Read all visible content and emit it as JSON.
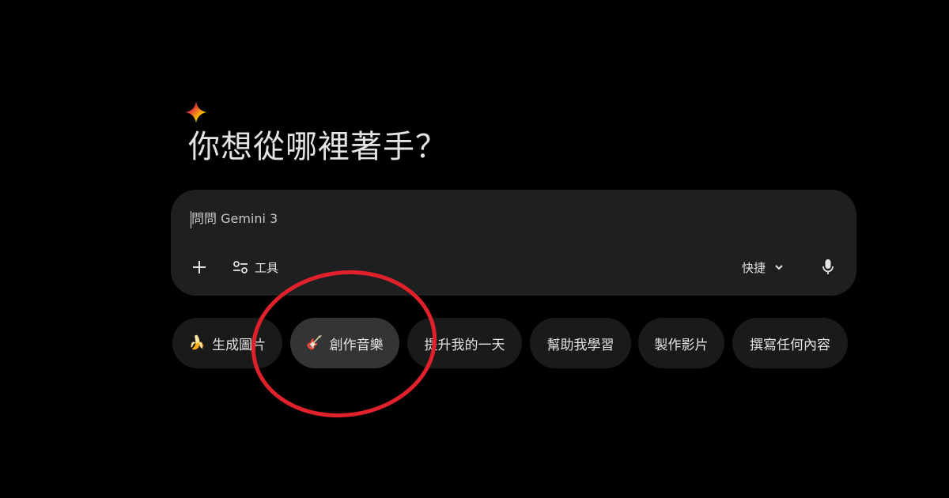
{
  "header": {
    "logo_icon": "gemini-sparkle-icon",
    "title": "你想從哪裡著手？"
  },
  "composer": {
    "placeholder": "問問 Gemini 3",
    "add_icon": "plus-icon",
    "tools_icon": "tune-icon",
    "tools_label": "工具",
    "mode_label": "快捷",
    "mode_icon": "chevron-down-icon",
    "mic_icon": "mic-icon"
  },
  "chips": [
    {
      "emoji": "🍌",
      "label": "生成圖片"
    },
    {
      "emoji": "🎸",
      "label": "創作音樂"
    },
    {
      "emoji": "",
      "label": "提升我的一天"
    },
    {
      "emoji": "",
      "label": "幫助我學習"
    },
    {
      "emoji": "",
      "label": "製作影片"
    },
    {
      "emoji": "",
      "label": "撰寫任何內容"
    }
  ],
  "colors": {
    "background": "#000000",
    "composer": "#1e1f20",
    "chip": "#1a1a1b",
    "chip_active": "#333435",
    "text": "#e3e3e3",
    "annotation": "#e0202a"
  }
}
